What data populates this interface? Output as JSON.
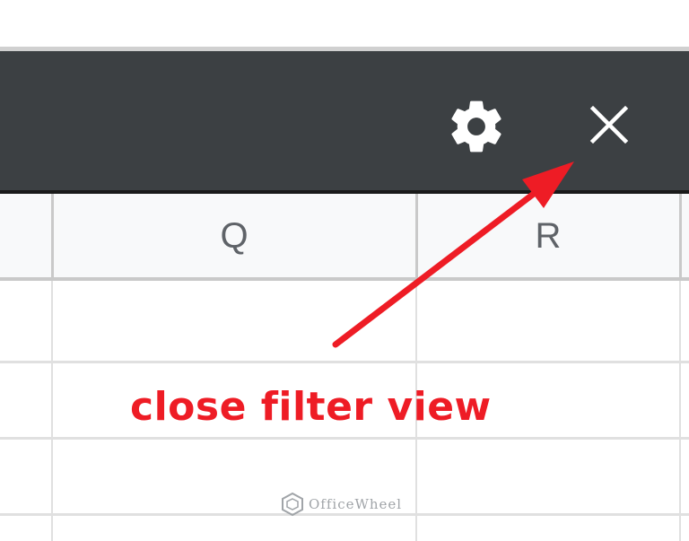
{
  "toolbar": {
    "settings_icon": "gear-icon",
    "close_icon": "close-icon",
    "background_color": "#3c4043"
  },
  "grid": {
    "columns": [
      "Q",
      "R"
    ]
  },
  "annotation": {
    "text": "close filter view",
    "color": "#ee1c25"
  },
  "watermark": {
    "text": "OfficeWheel"
  }
}
